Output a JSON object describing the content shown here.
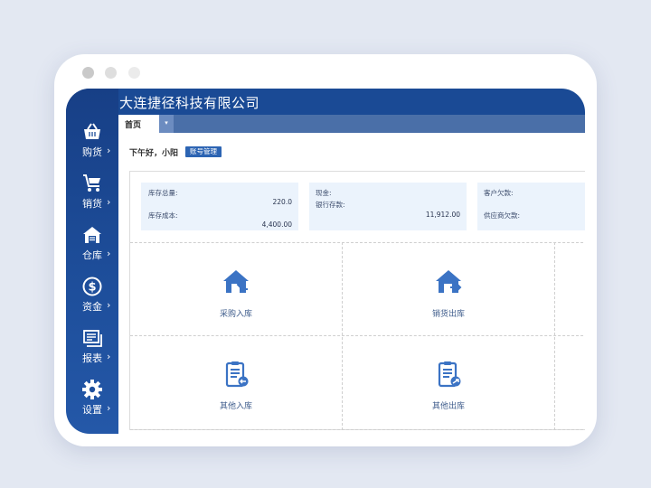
{
  "app": {
    "company_name": "大连捷径科技有限公司"
  },
  "sidebar": {
    "items": [
      {
        "label": "购货",
        "icon": "basket-icon"
      },
      {
        "label": "销货",
        "icon": "cart-icon"
      },
      {
        "label": "仓库",
        "icon": "warehouse-icon"
      },
      {
        "label": "资金",
        "icon": "dollar-icon"
      },
      {
        "label": "报表",
        "icon": "report-icon"
      },
      {
        "label": "设置",
        "icon": "gear-icon"
      }
    ],
    "arrow": "›"
  },
  "tabs": {
    "home_label": "首页",
    "dropdown": "▾"
  },
  "greeting": {
    "text": "下午好，小阳",
    "account_button": "账号管理"
  },
  "summary": {
    "inventory_total_label": "库存总量:",
    "inventory_total_value": "220.0",
    "inventory_cost_label": "库存成本:",
    "inventory_cost_value": "4,400.00",
    "cash_label": "现金:",
    "bank_label": "银行存款:",
    "bank_value": "11,912.00",
    "customer_debt_label": "客户欠款:",
    "supplier_debt_label": "供应商欠款:"
  },
  "quick_actions": [
    {
      "label": "采购入库",
      "icon": "house-in-icon"
    },
    {
      "label": "销货出库",
      "icon": "house-out-icon"
    },
    {
      "label": "其他入库",
      "icon": "clipboard-in-icon"
    },
    {
      "label": "其他出库",
      "icon": "clipboard-out-icon"
    }
  ],
  "colors": {
    "brand": "#1a4a95",
    "accent": "#3b73c4",
    "card_bg": "#ebf3fc"
  }
}
